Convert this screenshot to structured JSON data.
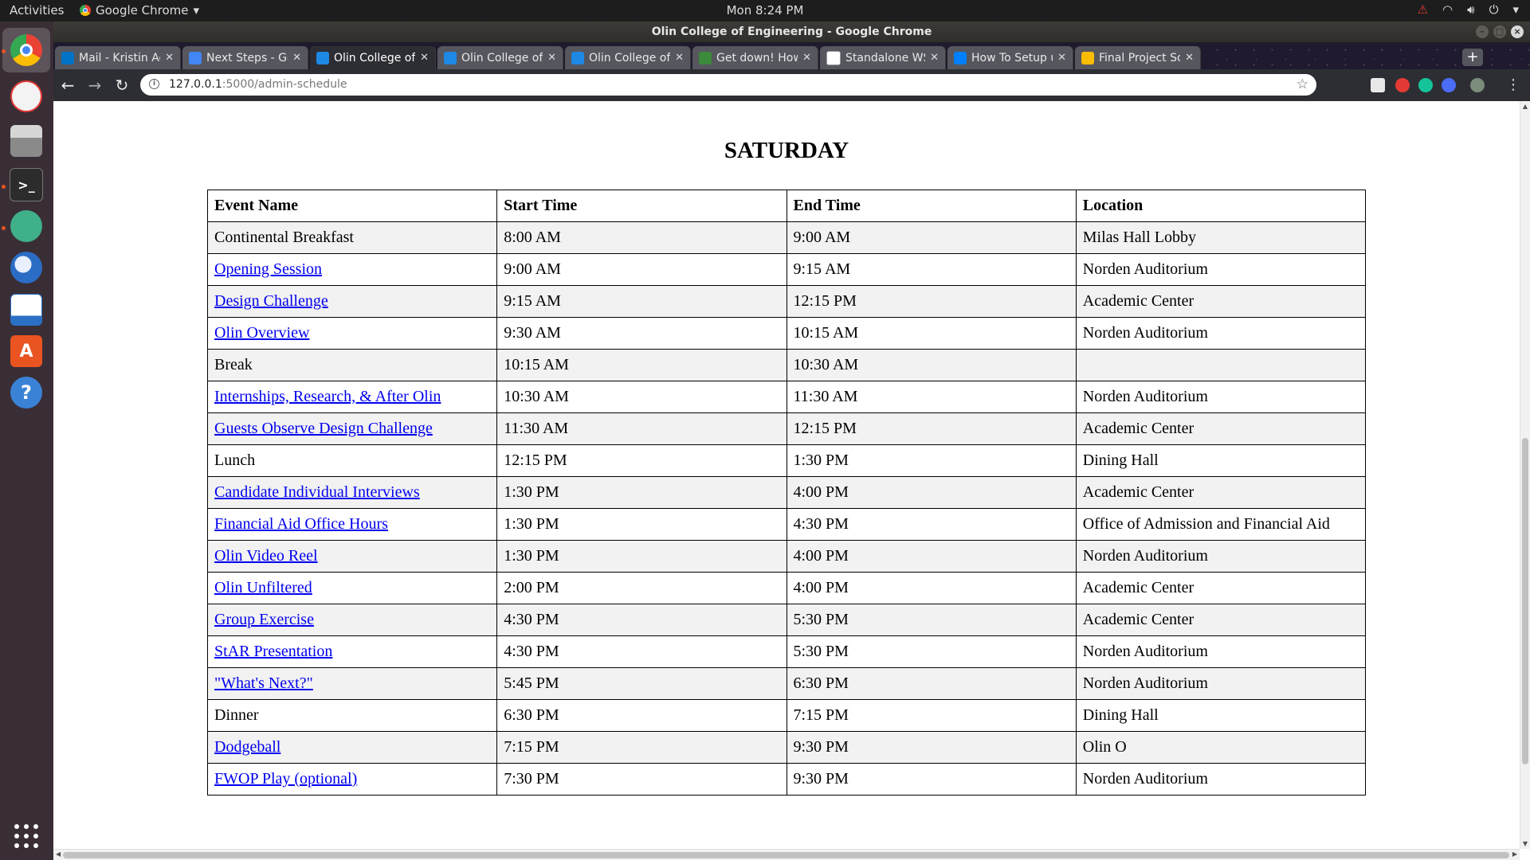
{
  "topbar": {
    "activities": "Activities",
    "app_name": "Google Chrome",
    "app_menu_arrow": "▾",
    "clock": "Mon  8:24 PM",
    "tray_icons": [
      "warning-icon",
      "wifi-icon",
      "volume-icon",
      "power-icon",
      "menu-arrow-icon"
    ]
  },
  "dock": {
    "items": [
      "chrome",
      "rhythmbox",
      "files",
      "terminal",
      "atom",
      "thunderbird",
      "writer",
      "software-center",
      "help",
      "show-applications"
    ],
    "terminal_glyph": ">_",
    "help_glyph": "?",
    "software_glyph": "A"
  },
  "window": {
    "title": "Olin College of Engineering - Google Chrome"
  },
  "tabs": [
    {
      "title": "Mail - Kristin Aoki - ",
      "icon": "outlook-icon",
      "color": "#0072c6",
      "active": false
    },
    {
      "title": "Next Steps - Google ",
      "icon": "google-docs-icon",
      "color": "#4285f4",
      "active": false
    },
    {
      "title": "Olin College of Eng",
      "icon": "olin-icon",
      "color": "#1e88e5",
      "active": true
    },
    {
      "title": "Olin College of Eng",
      "icon": "olin-icon",
      "color": "#1e88e5",
      "active": false
    },
    {
      "title": "Olin College of Eng",
      "icon": "olin-icon",
      "color": "#1e88e5",
      "active": false
    },
    {
      "title": "Get down! How to ",
      "icon": "stackoverflow-icon",
      "color": "#3c8a3c",
      "active": false
    },
    {
      "title": "Standalone WSGI C",
      "icon": "flask-icon",
      "color": "#ffffff",
      "active": false
    },
    {
      "title": "How To Setup uWS",
      "icon": "digitalocean-icon",
      "color": "#0080ff",
      "active": false
    },
    {
      "title": "Final Project Softw",
      "icon": "google-drive-icon",
      "color": "#fbbc05",
      "active": false
    }
  ],
  "tab_close": "✕",
  "new_tab": "+",
  "toolbar": {
    "back": "←",
    "forward": "→",
    "reload": "↻",
    "url_host": "127.0.0.1",
    "url_path": ":5000/admin-schedule",
    "star": "☆"
  },
  "page": {
    "day": "SATURDAY",
    "columns": [
      "Event Name",
      "Start Time",
      "End Time",
      "Location"
    ],
    "rows": [
      {
        "event": "Continental Breakfast",
        "link": false,
        "start": "8:00 AM",
        "end": "9:00 AM",
        "location": "Milas Hall Lobby"
      },
      {
        "event": "Opening Session",
        "link": true,
        "start": "9:00 AM",
        "end": "9:15 AM",
        "location": "Norden Auditorium"
      },
      {
        "event": "Design Challenge",
        "link": true,
        "start": "9:15 AM",
        "end": "12:15 PM",
        "location": "Academic Center"
      },
      {
        "event": "Olin Overview",
        "link": true,
        "start": "9:30 AM",
        "end": "10:15 AM",
        "location": "Norden Auditorium"
      },
      {
        "event": "Break",
        "link": false,
        "start": "10:15 AM",
        "end": "10:30 AM",
        "location": ""
      },
      {
        "event": "Internships, Research, & After Olin",
        "link": true,
        "start": "10:30 AM",
        "end": "11:30 AM",
        "location": "Norden Auditorium"
      },
      {
        "event": "Guests Observe Design Challenge",
        "link": true,
        "start": "11:30 AM",
        "end": "12:15 PM",
        "location": "Academic Center"
      },
      {
        "event": "Lunch",
        "link": false,
        "start": "12:15 PM",
        "end": "1:30 PM",
        "location": "Dining Hall"
      },
      {
        "event": "Candidate Individual Interviews",
        "link": true,
        "start": "1:30 PM",
        "end": "4:00 PM",
        "location": "Academic Center"
      },
      {
        "event": "Financial Aid Office Hours",
        "link": true,
        "start": "1:30 PM",
        "end": "4:30 PM",
        "location": "Office of Admission and Financial Aid"
      },
      {
        "event": "Olin Video Reel",
        "link": true,
        "start": "1:30 PM",
        "end": "4:00 PM",
        "location": "Norden Auditorium"
      },
      {
        "event": "Olin Unfiltered",
        "link": true,
        "start": "2:00 PM",
        "end": "4:00 PM",
        "location": "Academic Center"
      },
      {
        "event": "Group Exercise",
        "link": true,
        "start": "4:30 PM",
        "end": "5:30 PM",
        "location": "Academic Center"
      },
      {
        "event": "StAR Presentation",
        "link": true,
        "start": "4:30 PM",
        "end": "5:30 PM",
        "location": "Norden Auditorium"
      },
      {
        "event": "\"What's Next?\"",
        "link": true,
        "start": "5:45 PM",
        "end": "6:30 PM",
        "location": "Norden Auditorium"
      },
      {
        "event": "Dinner",
        "link": false,
        "start": "6:30 PM",
        "end": "7:15 PM",
        "location": "Dining Hall"
      },
      {
        "event": "Dodgeball",
        "link": true,
        "start": "7:15 PM",
        "end": "9:30 PM",
        "location": "Olin O"
      },
      {
        "event": "FWOP Play (optional)",
        "link": true,
        "start": "7:30 PM",
        "end": "9:30 PM",
        "location": "Norden Auditorium"
      }
    ]
  },
  "colors": {
    "link": "#0000ee",
    "row_stripe": "#f2f2f2",
    "dock_bg": "#3a2e36",
    "topbar_bg": "#1d1d1d",
    "accent": "#e95420"
  }
}
